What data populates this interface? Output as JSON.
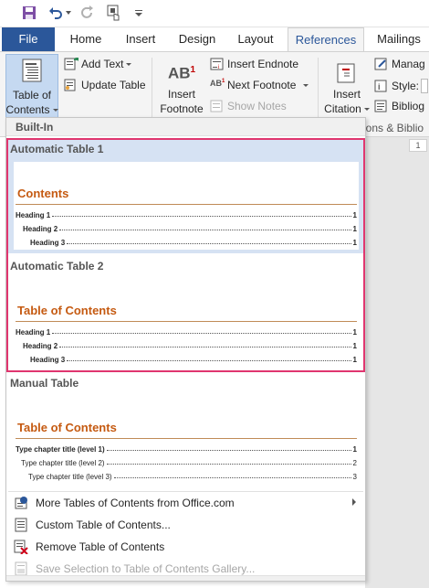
{
  "qat": {
    "icons": [
      "save-icon",
      "undo-icon",
      "redo-icon",
      "touch-mode-icon",
      "customize-qat-icon"
    ]
  },
  "tabs": [
    {
      "label": "File"
    },
    {
      "label": "Home"
    },
    {
      "label": "Insert"
    },
    {
      "label": "Design"
    },
    {
      "label": "Layout"
    },
    {
      "label": "References"
    },
    {
      "label": "Mailings"
    }
  ],
  "ribbon": {
    "toc_button": {
      "line1": "Table of",
      "line2": "Contents"
    },
    "add_text": "Add Text",
    "update_table": "Update Table",
    "insert_footnote": {
      "line1": "Insert",
      "line2": "Footnote"
    },
    "insert_endnote": "Insert Endnote",
    "next_footnote": "Next Footnote",
    "show_notes": "Show Notes",
    "insert_citation": {
      "line1": "Insert",
      "line2": "Citation"
    },
    "manage_sources": "Manag",
    "style": "Style:",
    "bibliography": "Bibliog",
    "group_label": "ions & Biblio",
    "footnote_glyph": "AB",
    "footnote_sup": "1",
    "next_footnote_glyph": "AB",
    "next_footnote_sup": "1"
  },
  "ruler": {
    "value": "1"
  },
  "gallery": {
    "section_label": "Built-In",
    "items": [
      {
        "title": "Automatic Table 1",
        "heading": "Contents",
        "lines": [
          {
            "text": "Heading 1",
            "page": "1"
          },
          {
            "text": "Heading 2",
            "page": "1"
          },
          {
            "text": "Heading 3",
            "page": "1"
          }
        ]
      },
      {
        "title": "Automatic Table 2",
        "heading": "Table of Contents",
        "lines": [
          {
            "text": "Heading 1",
            "page": "1"
          },
          {
            "text": "Heading 2",
            "page": "1"
          },
          {
            "text": "Heading 3",
            "page": "1"
          }
        ]
      },
      {
        "title": "Manual Table",
        "heading": "Table of Contents",
        "lines": [
          {
            "text": "Type chapter title (level 1)",
            "page": "1"
          },
          {
            "text": "Type chapter title (level 2)",
            "page": "2"
          },
          {
            "text": "Type chapter title (level 3)",
            "page": "3"
          }
        ]
      }
    ]
  },
  "menu": {
    "more_tables": "More Tables of Contents from Office.com",
    "custom_table": "Custom Table of Contents...",
    "remove_table": "Remove Table of Contents",
    "save_selection": "Save Selection to Table of Contents Gallery..."
  },
  "colors": {
    "file_tab": "#2b579a",
    "toc_heading": "#c55a11",
    "selection_highlight": "#d6e2f3",
    "red_outline": "#e0366f"
  }
}
